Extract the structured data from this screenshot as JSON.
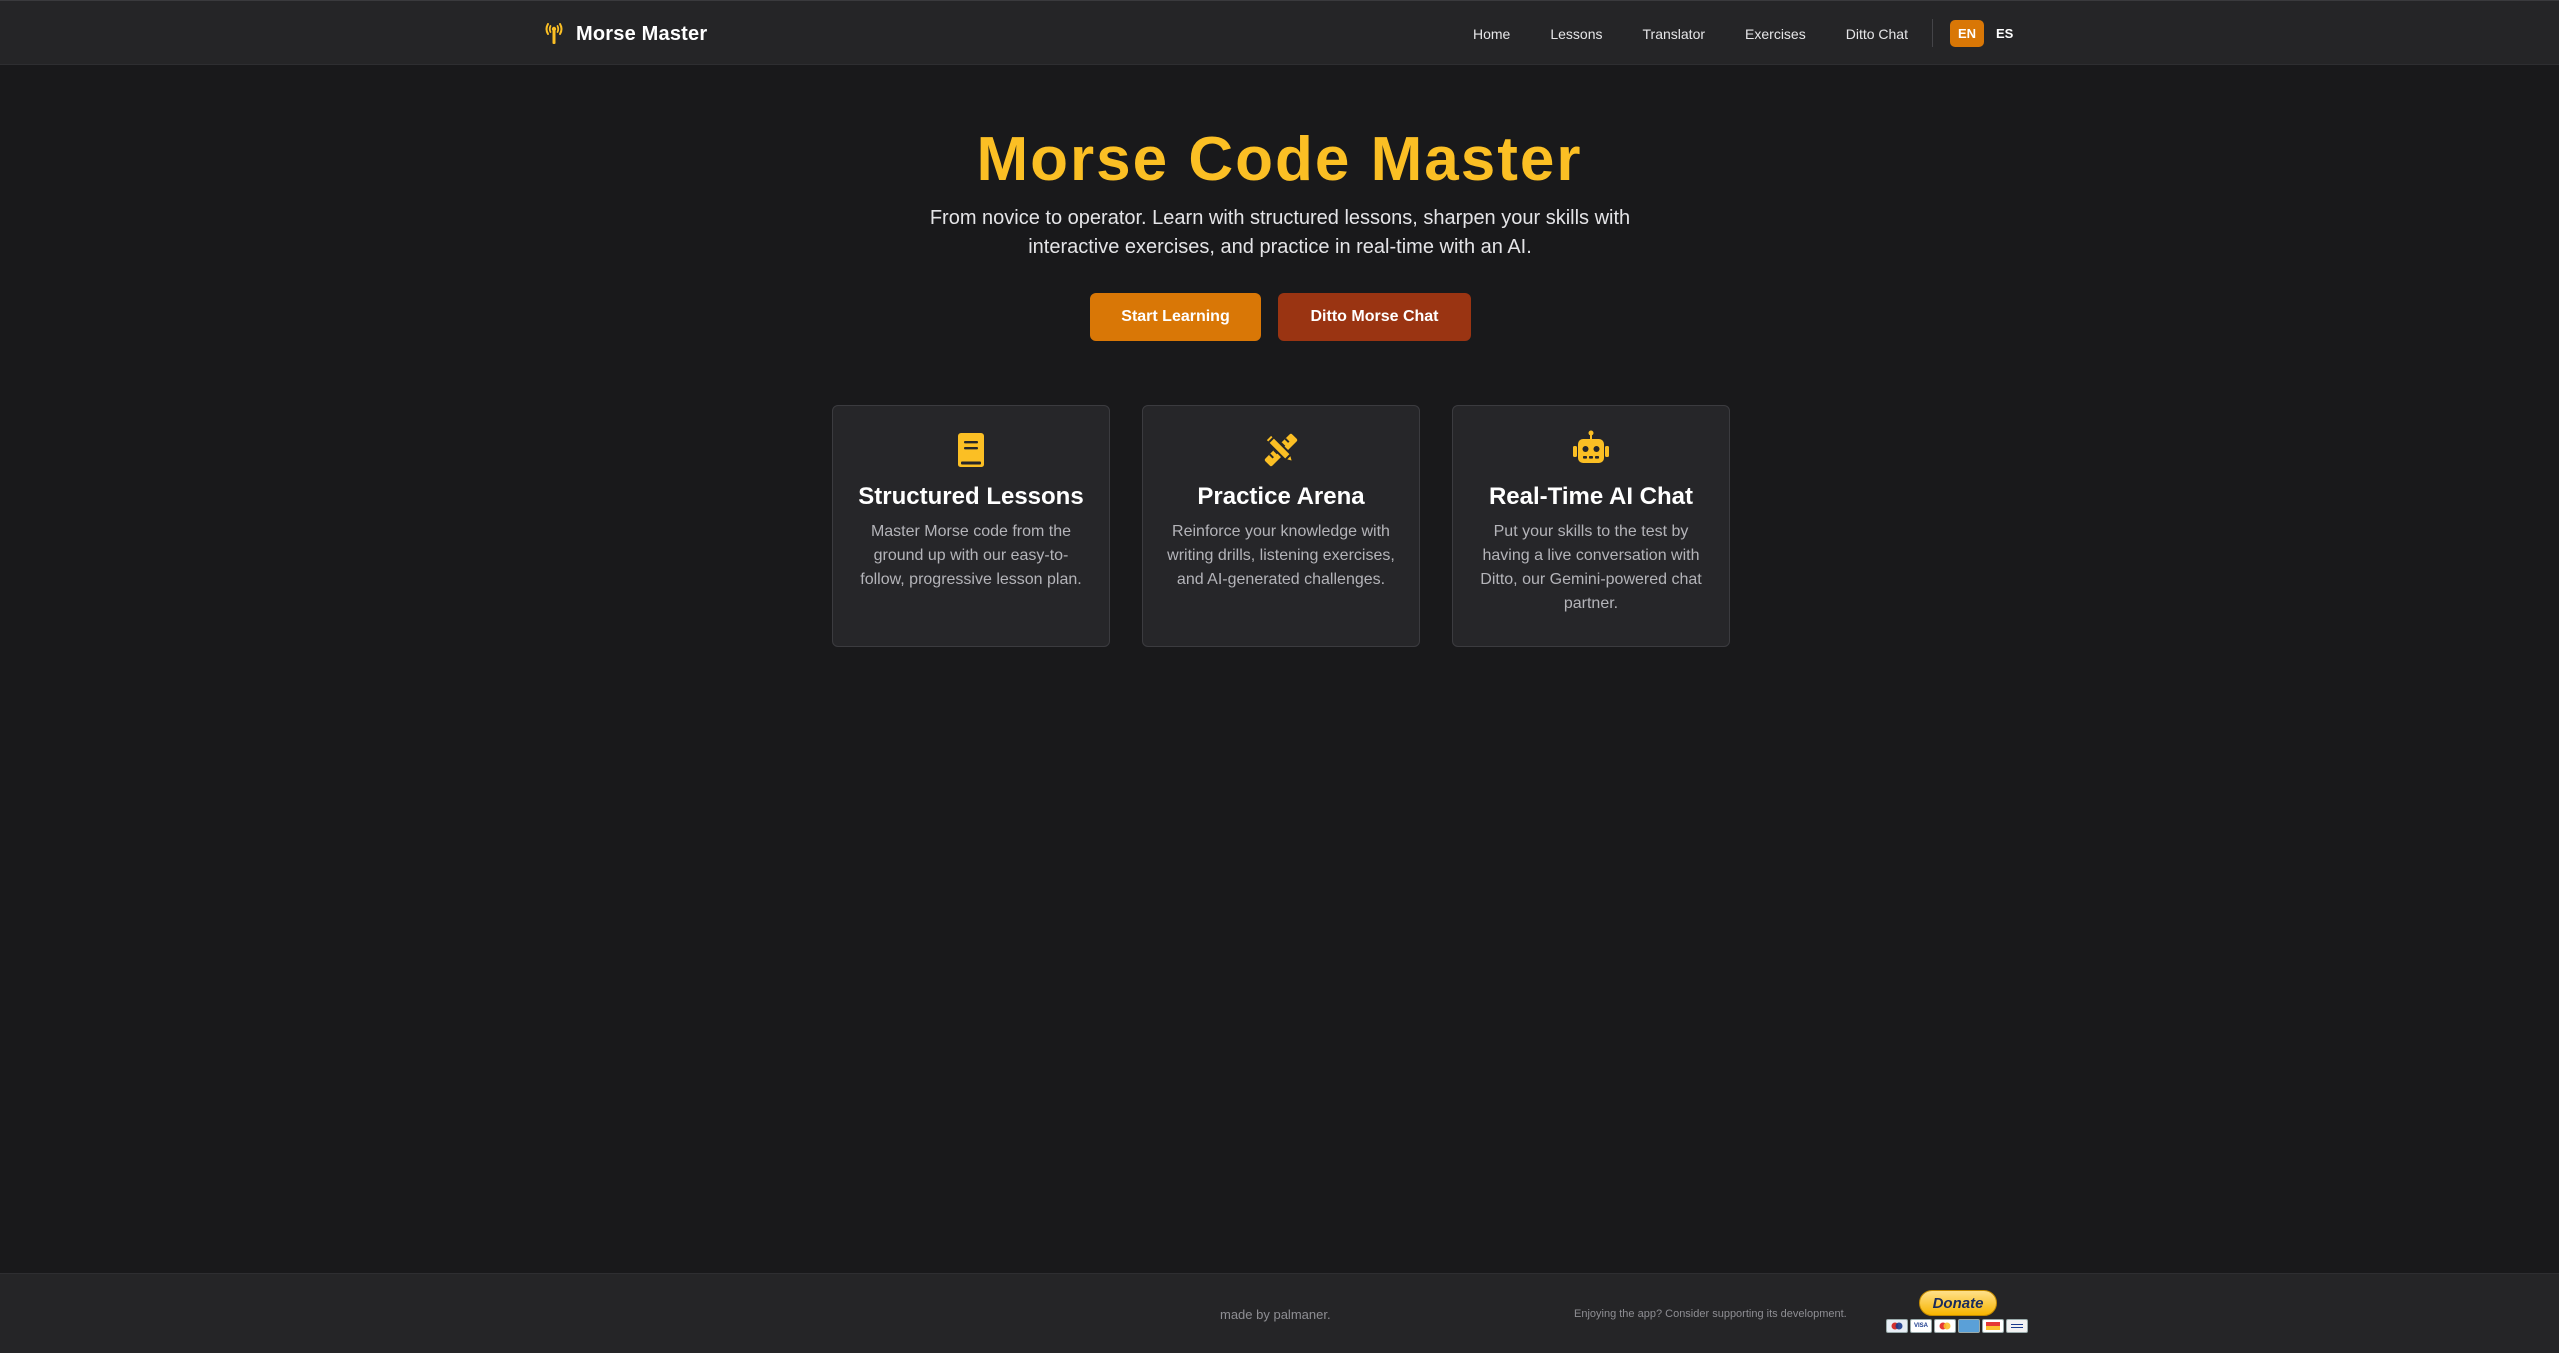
{
  "navbar": {
    "brand": "Morse Master",
    "links": [
      "Home",
      "Lessons",
      "Translator",
      "Exercises",
      "Ditto Chat"
    ],
    "languages": [
      "EN",
      "ES"
    ],
    "active_language": "EN",
    "accent": "#d97706"
  },
  "hero": {
    "title": "Morse Code Master",
    "subtitle": "From novice to operator. Learn with structured lessons, sharpen your skills with interactive exercises, and practice in real-time with an AI.",
    "primary_button": "Start Learning",
    "secondary_button": "Ditto Morse Chat",
    "title_color": "#fbbf24"
  },
  "features": [
    {
      "icon": "book-icon",
      "title": "Structured Lessons",
      "description": "Master Morse code from the ground up with our easy-to-follow, progressive lesson plan."
    },
    {
      "icon": "pencil-ruler-icon",
      "title": "Practice Arena",
      "description": "Reinforce your knowledge with writing drills, listening exercises, and AI-generated challenges."
    },
    {
      "icon": "robot-icon",
      "title": "Real-Time AI Chat",
      "description": "Put your skills to the test by having a live conversation with Ditto, our Gemini-powered chat partner."
    }
  ],
  "footer": {
    "credit": "made by palmaner.",
    "support_text": "Enjoying the app? Consider supporting its development.",
    "donate_label": "Donate"
  }
}
